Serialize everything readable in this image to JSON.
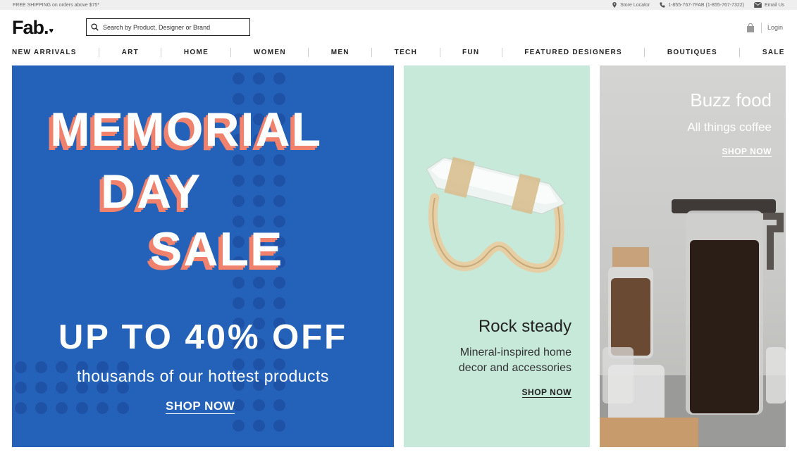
{
  "topbar": {
    "shipping": "FREE SHIPPING on orders above $75*",
    "store_locator": "Store Locator",
    "phone": "1-855-767-7FAB (1-855-767-7322)",
    "email": "Email Us"
  },
  "header": {
    "logo": "Fab.",
    "search_placeholder": "Search by Product, Designer or Brand",
    "login": "Login"
  },
  "nav": [
    "NEW ARRIVALS",
    "ART",
    "HOME",
    "WOMEN",
    "MEN",
    "TECH",
    "FUN",
    "FEATURED DESIGNERS",
    "BOUTIQUES",
    "SALE"
  ],
  "hero": {
    "line1": "MEMORIAL",
    "line2": "DAY",
    "line3": "SALE",
    "offer": "UP TO 40% OFF",
    "subtitle": "thousands of our hottest products",
    "cta": "SHOP NOW",
    "colors": {
      "background": "#2461b8",
      "shadow": "#f0826d",
      "dots": "#1e52a6"
    }
  },
  "promo_mid": {
    "title": "Rock steady",
    "line1": "Mineral-inspired home",
    "line2": "decor and accessories",
    "cta": "SHOP NOW",
    "background": "#c7e9d9"
  },
  "promo_right": {
    "title": "Buzz food",
    "subtitle": "All things coffee",
    "cta": "SHOP NOW"
  }
}
